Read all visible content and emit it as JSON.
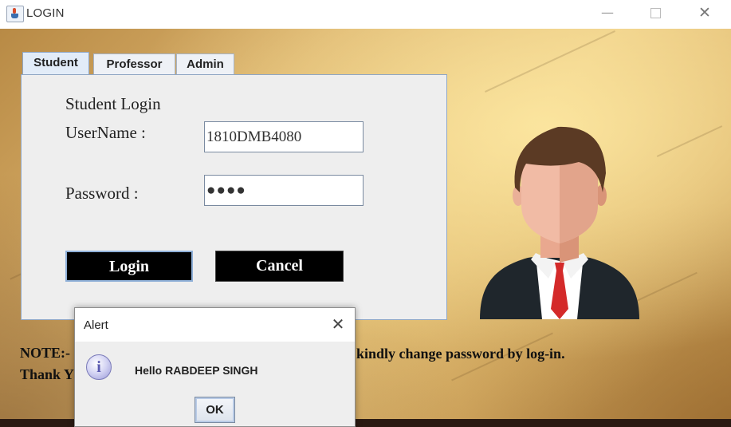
{
  "window": {
    "title": "LOGIN",
    "minimize_glyph": "—",
    "close_glyph": "✕"
  },
  "tabs": [
    {
      "label": "Student",
      "active": true
    },
    {
      "label": "Professor",
      "active": false
    },
    {
      "label": "Admin",
      "active": false
    }
  ],
  "form": {
    "heading": "Student Login",
    "username_label": "UserName :",
    "username_value": "1810DMB4080",
    "password_label": "Password :",
    "password_value": "●●●●",
    "login_label": "Login",
    "cancel_label": "Cancel"
  },
  "note": {
    "line1_visible": "NOTE:-",
    "line2_visible": "Thank Y",
    "line1_right": "kindly change password by log-in."
  },
  "alert": {
    "title": "Alert",
    "close_glyph": "✕",
    "icon": "info-icon",
    "icon_glyph": "i",
    "message": "Hello RABDEEP SINGH",
    "ok_label": "OK"
  },
  "colors": {
    "button_bg": "#000000",
    "tab_active": "#e2ecf8",
    "panel_bg": "#eeeeee",
    "tie": "#d42a2a",
    "suit": "#1f262c"
  }
}
